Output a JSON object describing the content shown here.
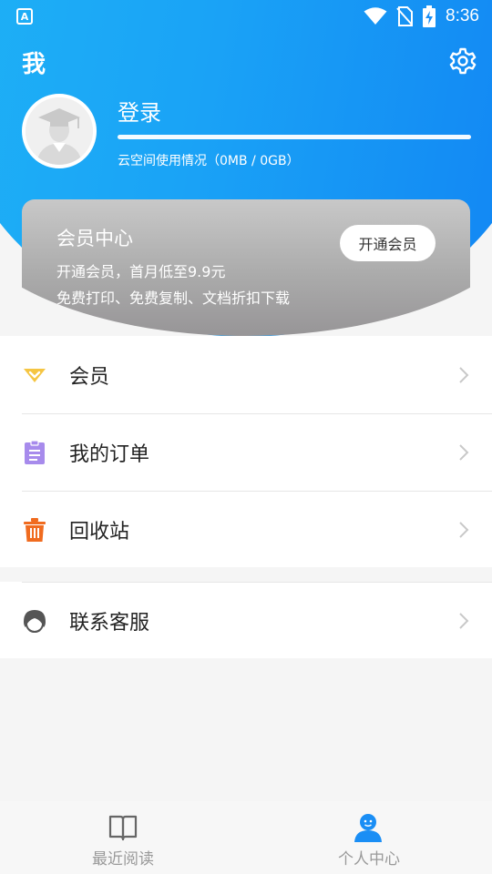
{
  "status_bar": {
    "time": "8:36",
    "app_icon_letter": "A",
    "icons": [
      "wifi-icon",
      "no-sim-icon",
      "battery-charging-icon"
    ]
  },
  "header": {
    "title": "我",
    "settings_icon": "gear-icon"
  },
  "profile": {
    "login_label": "登录",
    "cloud_usage_text": "云空间使用情况（0MB / 0GB）",
    "cloud_usage_fraction": 0
  },
  "vip_card": {
    "title": "会员中心",
    "line1": "开通会员，首月低至9.9元",
    "line2": "免费打印、免费复制、文档折扣下载",
    "button_label": "开通会员"
  },
  "menu": {
    "items": [
      {
        "label": "会员",
        "icon": "diamond-icon",
        "color": "#f5c542"
      },
      {
        "label": "我的订单",
        "icon": "clipboard-icon",
        "color": "#a78bec"
      },
      {
        "label": "回收站",
        "icon": "trash-icon",
        "color": "#f06b1f"
      },
      {
        "label": "联系客服",
        "icon": "customer-service-icon",
        "color": "#555555"
      }
    ]
  },
  "bottom_nav": {
    "items": [
      {
        "label": "最近阅读",
        "icon": "book-icon"
      },
      {
        "label": "个人中心",
        "icon": "person-icon",
        "active": true
      }
    ]
  },
  "colors": {
    "accent": "#1a8ef5",
    "vip_gray": "#a9a9a9",
    "nav_inactive": "#999999"
  }
}
